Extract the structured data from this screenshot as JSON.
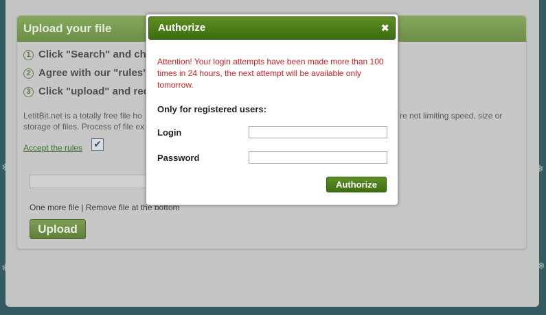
{
  "background_snowflakes": [
    {
      "name": "snowflake-1"
    },
    {
      "name": "snowflake-2"
    },
    {
      "name": "snowflake-3"
    },
    {
      "name": "snowflake-4"
    }
  ],
  "upload_panel": {
    "title": "Upload your file",
    "steps": [
      {
        "num": "1",
        "text": "Click \"Search\" and cho"
      },
      {
        "num": "2",
        "text": "Agree with our \"rules\""
      },
      {
        "num": "3",
        "text": "Click \"upload\" and rece"
      }
    ],
    "description_left": "LetitBit.net is a totally free file ho",
    "description_left_line2": "storage of files. Process of file ex",
    "description_right": "re not limiting speed, size or",
    "accept_label": "Accept the rules",
    "accept_checked": true,
    "more_files_text": "One more file | Remove file at the bottom",
    "upload_label": "Upload"
  },
  "modal": {
    "title": "Authorize",
    "close_symbol": "✖",
    "attention": "Attention! Your login attempts have been made more than 100 times in 24 hours, the next attempt will be available only tomorrow.",
    "registered_label": "Only for registered users:",
    "login_label": "Login",
    "login_value": "",
    "password_label": "Password",
    "password_value": "",
    "submit_label": "Authorize"
  },
  "colors": {
    "attention_text": "#cc1f1f",
    "modal_header_green": "#4a7d17",
    "panel_header_green": "#7a9b52"
  }
}
